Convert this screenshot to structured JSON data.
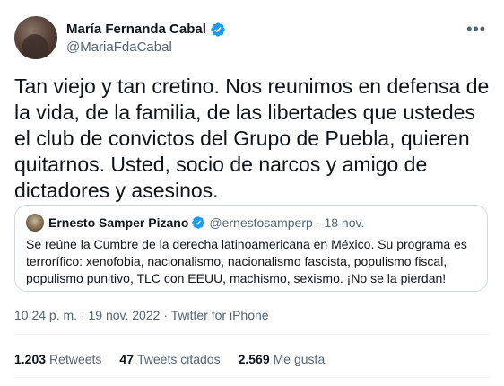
{
  "author": {
    "display_name": "María Fernanda Cabal",
    "handle": "@MariaFdaCabal",
    "verified": true
  },
  "more_icon": "more-horizontal-icon",
  "tweet": {
    "text": "Tan viejo y tan cretino. Nos reunimos en defensa de la vida, de la familia, de las libertades que ustedes el club de convictos del Grupo de Puebla, quieren quitarnos. Usted, socio de narcos y amigo de dictadores y asesinos."
  },
  "quote": {
    "display_name": "Ernesto Samper Pizano",
    "handle": "@ernestosamperp",
    "separator": "·",
    "date": "18 nov.",
    "text": "Se reúne la Cumbre de la derecha latinoamericana en México. Su programa es terrorífico: xenofobia, nacionalismo, nacionalismo fascista, populismo fiscal, populismo punitivo, TLC con EEUU, machismo, sexismo. ¡No se la pierdan!"
  },
  "meta": {
    "time": "10:24 p. m.",
    "separator1": "·",
    "date": "19 nov. 2022",
    "separator2": "·",
    "client": "Twitter for iPhone"
  },
  "stats": [
    {
      "count": "1.203",
      "label": "Retweets"
    },
    {
      "count": "47",
      "label": "Tweets citados"
    },
    {
      "count": "2.569",
      "label": "Me gusta"
    }
  ],
  "colors": {
    "verified_blue": "#1d9bf0",
    "secondary_text": "#536471",
    "border": "#cfd9de"
  }
}
